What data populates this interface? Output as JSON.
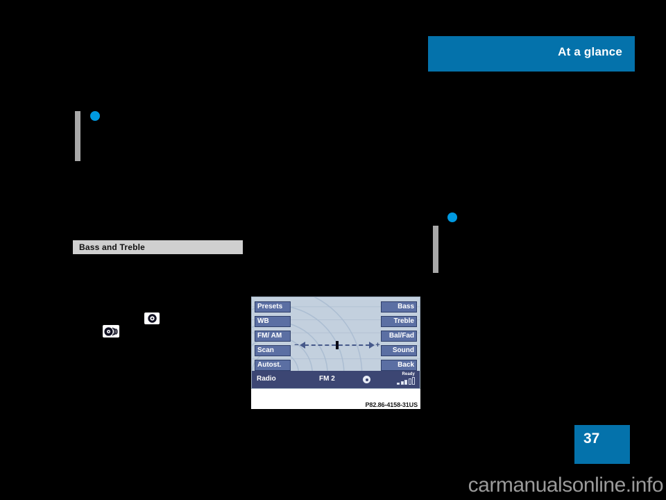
{
  "header": {
    "tab_label": "At a glance",
    "accent_color": "#0472ab"
  },
  "section": {
    "heading": "Bass and Treble",
    "band_color": "#cfcfcf"
  },
  "margin_markers": {
    "left": {
      "bullet": "●",
      "bullet_color": "#0099e0",
      "bar_color": "#a8a8a8"
    },
    "right": {
      "bullet": "●",
      "bullet_color": "#0099e0",
      "bar_color": "#a8a8a8"
    }
  },
  "media_icons": [
    {
      "name": "cd-single-icon",
      "glyph": "◉"
    },
    {
      "name": "cd-changer-icon",
      "glyph": "◉"
    }
  ],
  "figure": {
    "caption": "P82.86-4158-31US",
    "screen": {
      "left_buttons": [
        {
          "label": "Presets"
        },
        {
          "label": "WB"
        },
        {
          "label": "FM/ AM"
        },
        {
          "label": "Scan"
        },
        {
          "label": "Autost."
        }
      ],
      "right_buttons": [
        {
          "label": "Bass"
        },
        {
          "label": "Treble"
        },
        {
          "label": "Bal/Fad"
        },
        {
          "label": "Sound"
        },
        {
          "label": "Back"
        }
      ],
      "slider": {
        "minus_label": "−",
        "plus_label": "+",
        "position_percent": 50
      },
      "status": {
        "source": "Radio",
        "band": "FM 2",
        "disc_icon": "disc-icon",
        "signal_label": "Ready",
        "signal_bars": [
          1,
          2,
          3,
          0,
          0
        ]
      },
      "colors": {
        "screen_bg": "#c3d0de",
        "button_fill": "#5b6fa3",
        "status_bar": "#3c4673"
      }
    }
  },
  "page": {
    "number": "37"
  },
  "watermark": {
    "text": "carmanualsonline.info"
  }
}
